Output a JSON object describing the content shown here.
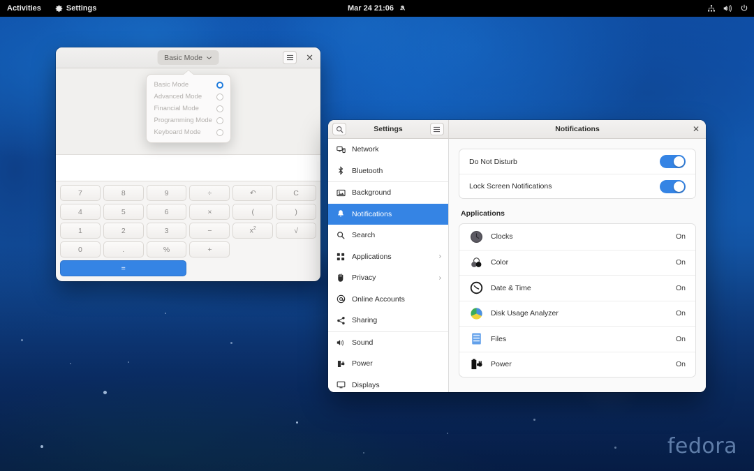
{
  "topbar": {
    "activities": "Activities",
    "app_menu": "Settings",
    "app_menu_icon": "gear-icon",
    "clock": "Mar 24  21:06",
    "notification_icon": "notifications-disabled-icon",
    "right_icons": [
      "network-wired-icon",
      "volume-icon",
      "power-icon"
    ]
  },
  "calculator": {
    "mode_button": "Basic Mode",
    "mode_chevron": "chevron-down-icon",
    "menu_icon": "hamburger-menu-icon",
    "close_icon": "close-icon",
    "display_value": "",
    "modes": [
      {
        "label": "Basic Mode",
        "selected": true
      },
      {
        "label": "Advanced Mode",
        "selected": false
      },
      {
        "label": "Financial Mode",
        "selected": false
      },
      {
        "label": "Programming Mode",
        "selected": false
      },
      {
        "label": "Keyboard Mode",
        "selected": false
      }
    ],
    "keys": [
      {
        "label": "7",
        "style": "normal"
      },
      {
        "label": "8",
        "style": "normal"
      },
      {
        "label": "9",
        "style": "normal"
      },
      {
        "label": "÷",
        "style": "normal"
      },
      {
        "label": "↶",
        "style": "normal"
      },
      {
        "label": "C",
        "style": "normal"
      },
      {
        "label": "4",
        "style": "normal"
      },
      {
        "label": "5",
        "style": "normal"
      },
      {
        "label": "6",
        "style": "normal"
      },
      {
        "label": "×",
        "style": "normal"
      },
      {
        "label": "(",
        "style": "normal"
      },
      {
        "label": ")",
        "style": "normal"
      },
      {
        "label": "1",
        "style": "normal"
      },
      {
        "label": "2",
        "style": "normal"
      },
      {
        "label": "3",
        "style": "normal"
      },
      {
        "label": "−",
        "style": "normal"
      },
      {
        "label": "x²",
        "style": "normal"
      },
      {
        "label": "√",
        "style": "normal"
      },
      {
        "label": "0",
        "style": "normal"
      },
      {
        "label": ".",
        "style": "normal"
      },
      {
        "label": "%",
        "style": "normal"
      },
      {
        "label": "+",
        "style": "normal"
      },
      {
        "label": "=",
        "style": "accent-wide"
      }
    ]
  },
  "settings": {
    "search_icon": "search-icon",
    "title": "Settings",
    "menu_icon": "hamburger-menu-icon",
    "panel_title": "Notifications",
    "close_icon": "close-icon",
    "sidebar": [
      {
        "label": "Network",
        "icon": "network-icon",
        "selected": false,
        "chevron": false
      },
      {
        "label": "Bluetooth",
        "icon": "bluetooth-icon",
        "selected": false,
        "chevron": false
      },
      {
        "label": "Background",
        "icon": "background-icon",
        "selected": false,
        "chevron": false
      },
      {
        "label": "Notifications",
        "icon": "bell-icon",
        "selected": true,
        "chevron": false
      },
      {
        "label": "Search",
        "icon": "search-icon",
        "selected": false,
        "chevron": false
      },
      {
        "label": "Applications",
        "icon": "applications-grid-icon",
        "selected": false,
        "chevron": true
      },
      {
        "label": "Privacy",
        "icon": "privacy-hand-icon",
        "selected": false,
        "chevron": true
      },
      {
        "label": "Online Accounts",
        "icon": "at-sign-icon",
        "selected": false,
        "chevron": false
      },
      {
        "label": "Sharing",
        "icon": "share-icon",
        "selected": false,
        "chevron": false
      },
      {
        "label": "Sound",
        "icon": "volume-icon",
        "selected": false,
        "chevron": false
      },
      {
        "label": "Power",
        "icon": "power-plug-icon",
        "selected": false,
        "chevron": false
      },
      {
        "label": "Displays",
        "icon": "display-monitor-icon",
        "selected": false,
        "chevron": false
      }
    ],
    "switches": [
      {
        "label": "Do Not Disturb",
        "value": "on"
      },
      {
        "label": "Lock Screen Notifications",
        "value": "on"
      }
    ],
    "applications_heading": "Applications",
    "applications": [
      {
        "name": "Clocks",
        "state": "On",
        "icon": "clocks-app-icon"
      },
      {
        "name": "Color",
        "state": "On",
        "icon": "color-app-icon"
      },
      {
        "name": "Date & Time",
        "state": "On",
        "icon": "date-time-app-icon"
      },
      {
        "name": "Disk Usage Analyzer",
        "state": "On",
        "icon": "disk-usage-analyzer-app-icon"
      },
      {
        "name": "Files",
        "state": "On",
        "icon": "files-app-icon"
      },
      {
        "name": "Power",
        "state": "On",
        "icon": "power-app-icon"
      }
    ]
  },
  "desktop": {
    "watermark": "fedora"
  },
  "colors": {
    "accent": "#3584e4",
    "selection": "#3584e4",
    "topbar_bg": "#000000",
    "window_bg": "#ffffff",
    "panel_bg": "#fafafa"
  }
}
